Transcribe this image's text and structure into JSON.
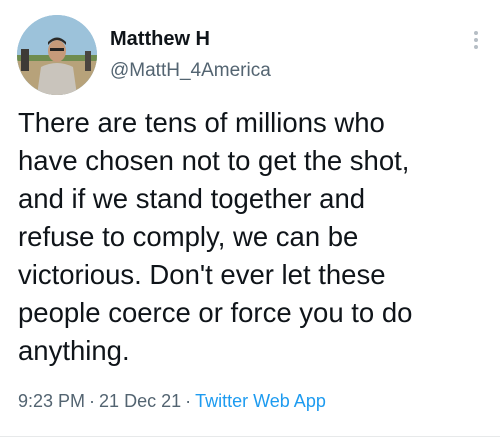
{
  "author": {
    "display_name": "Matthew H",
    "handle": "@MattH_4America",
    "avatar_icon": "profile-photo"
  },
  "menu": {
    "icon": "more-vertical-icon"
  },
  "tweet": {
    "text": "There are tens of millions who\nhave chosen not to get the shot,\nand if we stand together and\nrefuse to comply, we can be\nvictorious. Don't ever let these\npeople coerce or force you to do\nanything.",
    "time": "9:23 PM",
    "date": "21 Dec 21",
    "source": "Twitter Web App",
    "separator": "·"
  },
  "colors": {
    "text": "#0f1419",
    "secondary": "#536471",
    "link": "#1d9bf0",
    "divider": "#e7e9ea"
  }
}
